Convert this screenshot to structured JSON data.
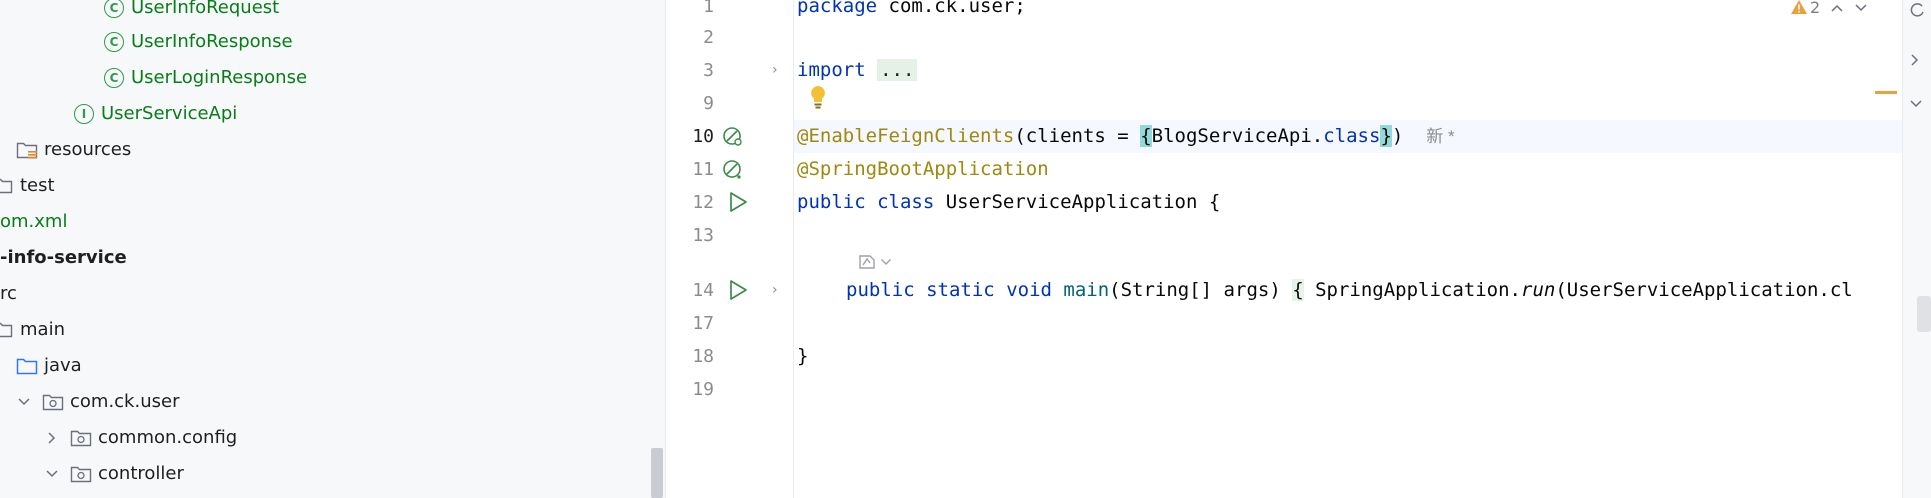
{
  "project_tree": {
    "items": [
      {
        "label": "UserInfoRequest",
        "icon": "class-icon",
        "color": "green"
      },
      {
        "label": "UserInfoResponse",
        "icon": "class-icon",
        "color": "green"
      },
      {
        "label": "UserLoginResponse",
        "icon": "class-icon",
        "color": "green"
      },
      {
        "label": "UserServiceApi",
        "icon": "interface-icon",
        "color": "green"
      },
      {
        "label": "resources",
        "icon": "resources-folder-icon"
      },
      {
        "label": "test",
        "icon": "folder-icon"
      },
      {
        "label": "om.xml",
        "icon": "none",
        "color": "green"
      },
      {
        "label": "-info-service",
        "icon": "none",
        "bold": true
      },
      {
        "label": "rc",
        "icon": "none"
      },
      {
        "label": "main",
        "icon": "folder-icon"
      },
      {
        "label": "java",
        "icon": "source-folder-icon"
      },
      {
        "label": "com.ck.user",
        "icon": "package-icon",
        "expanded": true
      },
      {
        "label": "common.config",
        "icon": "package-icon",
        "expanded": false
      },
      {
        "label": "controller",
        "icon": "package-icon",
        "expanded": true
      }
    ]
  },
  "gutter": {
    "line_numbers": [
      "1",
      "2",
      "3",
      "9",
      "10",
      "11",
      "12",
      "13",
      "14",
      "17",
      "18",
      "19"
    ]
  },
  "editor": {
    "line1": {
      "kw": "package",
      "rest": " com.ck.user;"
    },
    "line3": {
      "kw": "import",
      "dots": "..."
    },
    "line10": {
      "annotation": "@EnableFeignClients",
      "open": "(clients = ",
      "brace_open": "{",
      "type": "BlogServiceApi.",
      "kw": "class",
      "brace_close": "}",
      "close": ")",
      "inlay": "新 *"
    },
    "line11": {
      "annotation": "@SpringBootApplication"
    },
    "line12": {
      "kw1": "public",
      "kw2": "class",
      "name": " UserServiceApplication {"
    },
    "line14": {
      "kw1": "public",
      "kw2": "static",
      "kw3": "void",
      "method": "main",
      "params": "(String[] args) ",
      "brace": "{",
      "call_prefix": " SpringApplication.",
      "call_method": "run",
      "call_args": "(UserServiceApplication.cl"
    },
    "line18": {
      "text": "}"
    }
  },
  "inspections": {
    "warning_count": "2"
  },
  "colors": {
    "accent_green": "#067d17",
    "keyword_blue": "#0033b3",
    "annotation": "#9e880d",
    "brace_highlight": "#93d9d9"
  }
}
